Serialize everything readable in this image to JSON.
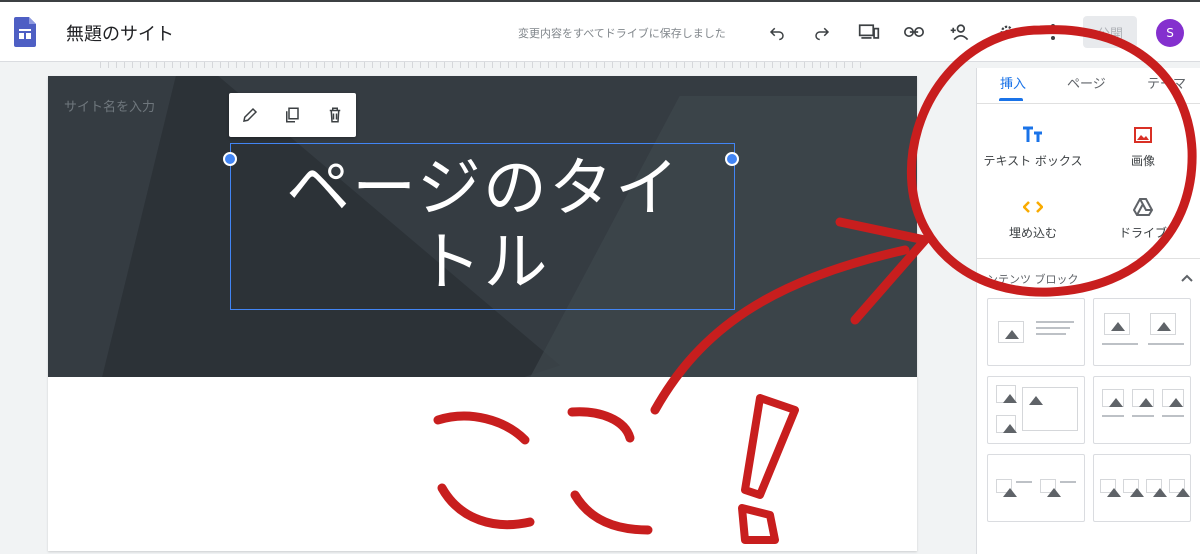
{
  "header": {
    "site_title": "無題のサイト",
    "save_status": "変更内容をすべてドライブに保存しました",
    "publish_label": "公開",
    "avatar_letter": "S",
    "icons": [
      "undo-icon",
      "redo-icon",
      "preview-devices-icon",
      "link-icon",
      "add-person-icon",
      "settings-icon",
      "more-vert-icon"
    ]
  },
  "canvas": {
    "site_name_placeholder": "サイト名を入力",
    "page_title_line1": "ページのタイ",
    "page_title_line2": "トル",
    "toolbar_icons": [
      "edit-icon",
      "copy-icon",
      "delete-icon"
    ]
  },
  "panel": {
    "tabs": [
      {
        "label": "挿入",
        "active": true
      },
      {
        "label": "ページ",
        "active": false
      },
      {
        "label": "テーマ",
        "active": false
      }
    ],
    "insert_items": [
      {
        "label": "テキスト ボックス",
        "icon": "text-box-icon",
        "color": "#1a73e8"
      },
      {
        "label": "画像",
        "icon": "image-icon",
        "color": "#d93025"
      },
      {
        "label": "埋め込む",
        "icon": "embed-icon",
        "color": "#f9ab00"
      },
      {
        "label": "ドライブ",
        "icon": "drive-icon",
        "color": "#5f6368"
      }
    ],
    "section_title": "ンテンツ ブロック"
  },
  "annotation": {
    "text": "ここ!",
    "color": "#c81e1e"
  },
  "colors": {
    "accent": "#1a73e8",
    "avatar": "#8430ce",
    "hero_bg": "#353c42"
  }
}
